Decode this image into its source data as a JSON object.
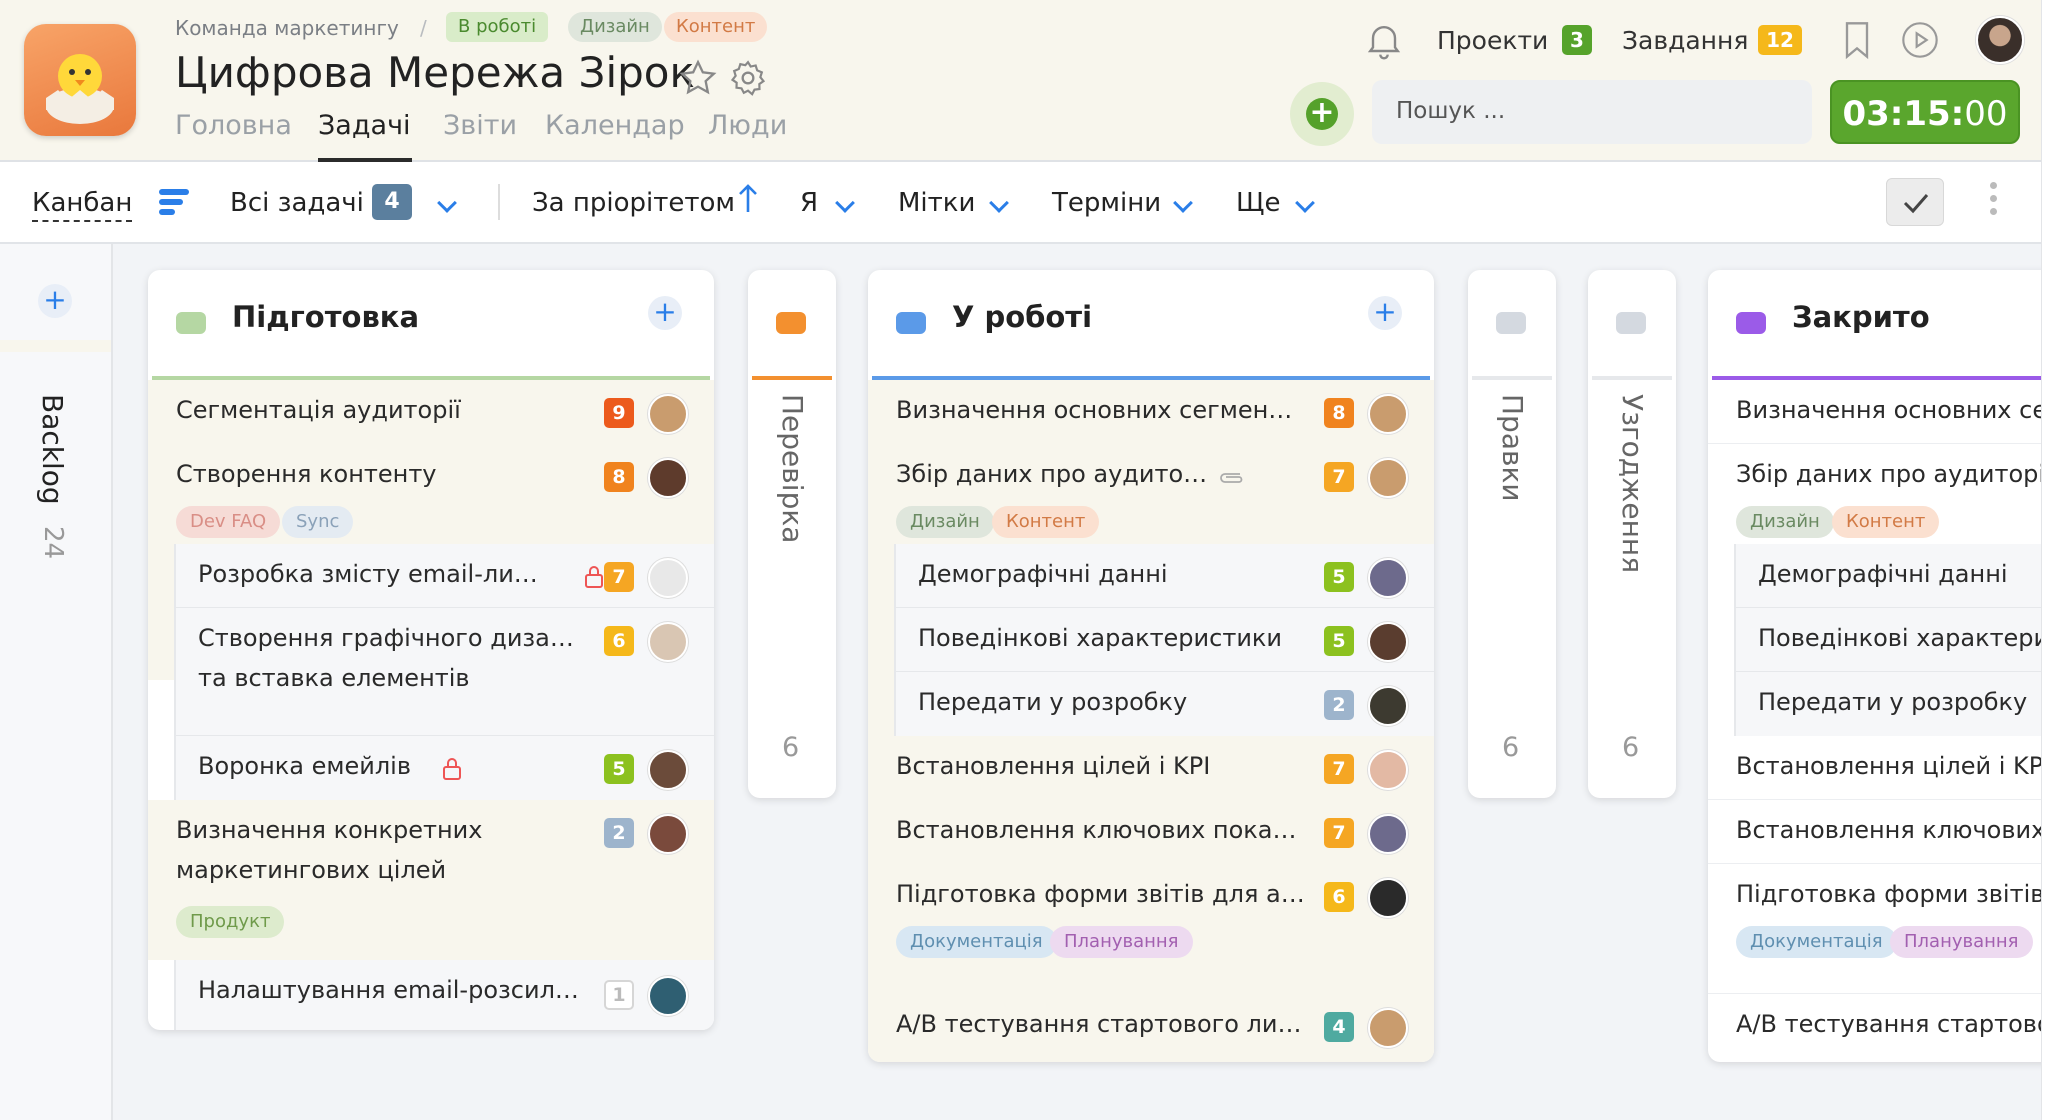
{
  "header": {
    "breadcrumb": "Команда маркетингу",
    "separator": "/",
    "status": "В роботі",
    "tag1": "Дизайн",
    "tag2": "Контент",
    "title": "Цифрова Мережа Зірок",
    "tabs": [
      "Головна",
      "Задачі",
      "Звіти",
      "Календар",
      "Люди"
    ],
    "projects_label": "Проекти",
    "projects_count": "3",
    "tasks_label": "Завдання",
    "tasks_count": "12",
    "search_placeholder": "Пошук ...",
    "timer_main": "03:15:",
    "timer_seconds": "00"
  },
  "toolbar": {
    "view": "Канбан",
    "all_tasks": "Всі задачі",
    "all_count": "4",
    "sort": "За пріорітетом",
    "me": "Я",
    "labels": "Мітки",
    "deadlines": "Терміни",
    "more": "Ще"
  },
  "sidebar": {
    "backlog": "Backlog",
    "backlog_count": "24"
  },
  "columns": {
    "prep": {
      "title": "Підготовка",
      "rows": [
        {
          "text": "Сегментація аудиторії",
          "num": "9"
        },
        {
          "text": "Створення контенту",
          "num": "8",
          "tags": [
            "Dev FAQ",
            "Sync"
          ]
        },
        {
          "text": "Розробка змісту email-листів",
          "num": "7"
        },
        {
          "text": "Створення графічного дизайну",
          "text2": "та вставка елементів",
          "num": "6"
        },
        {
          "text": "Воронка емейлів",
          "num": "5"
        },
        {
          "text": "Визначення конкретних",
          "text2": "маркетингових цілей",
          "num": "2",
          "tags": [
            "Продукт"
          ]
        },
        {
          "text": "Налаштування email-розсилок...",
          "num": "1"
        }
      ]
    },
    "review": {
      "title": "Перевірка",
      "count": "6"
    },
    "work": {
      "title": "У роботі",
      "rows": [
        {
          "text": "Визначення основних сегментів...",
          "num": "8"
        },
        {
          "text": "Збір даних про аудиторію",
          "num": "7",
          "tags": [
            "Дизайн",
            "Контент"
          ]
        },
        {
          "text": "Демографічні данні",
          "num": "5"
        },
        {
          "text": "Поведінкові характеристики",
          "num": "5"
        },
        {
          "text": "Передати у розробку",
          "num": "2"
        },
        {
          "text": "Встановлення цілей і KPI",
          "num": "7"
        },
        {
          "text": "Встановлення ключових показни...",
          "num": "7"
        },
        {
          "text": "Підготовка форми звітів для анал...",
          "num": "6",
          "tags": [
            "Документація",
            "Планування"
          ]
        },
        {
          "text": "A/B тестування стартового листа",
          "num": "4"
        }
      ]
    },
    "edits": {
      "title": "Правки",
      "count": "6"
    },
    "approve": {
      "title": "Узгодження",
      "count": "6"
    },
    "closed": {
      "title": "Закрито",
      "rows": [
        {
          "text": "Визначення основних сегм"
        },
        {
          "text": "Збір даних про аудиторію",
          "tags": [
            "Дизайн",
            "Контент"
          ]
        },
        {
          "text": "Демографічні данні"
        },
        {
          "text": "Поведінкові характерист"
        },
        {
          "text": "Передати у розробку"
        },
        {
          "text": "Встановлення цілей і KPI"
        },
        {
          "text": "Встановлення ключових по"
        },
        {
          "text": "Підготовка форми звітів дл",
          "tags": [
            "Документація",
            "Планування"
          ]
        },
        {
          "text": "A/B тестування стартового"
        }
      ]
    }
  },
  "colors": {
    "accent": "#2a7ee8",
    "timer": "#5aa62d",
    "orange": "#f0831e",
    "yellow": "#f5a623"
  }
}
